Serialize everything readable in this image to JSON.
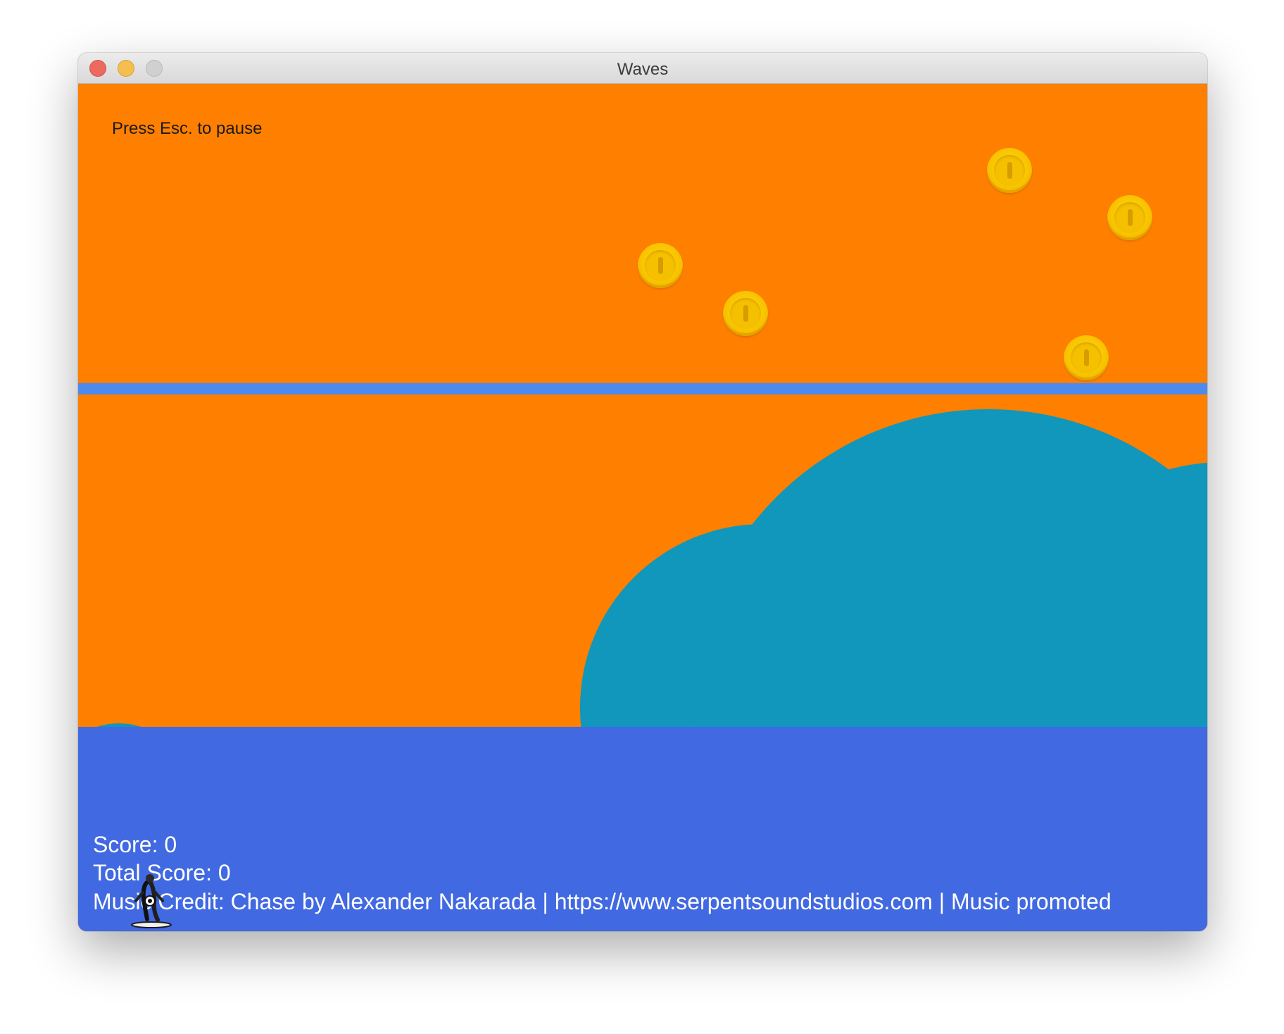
{
  "window": {
    "title": "Waves"
  },
  "hud": {
    "pause_hint": "Press Esc. to pause",
    "score": "Score: 0",
    "total_score": "Total Score: 0",
    "music_credit": "Music Credit: Chase by Alexander Nakarada | https://www.serpentsoundstudios.com | Music promoted"
  },
  "colors": {
    "sky": "#ff7f00",
    "horizon_line": "#4d8af0",
    "sea": "#4169e1",
    "hills": "#1097bb",
    "coin": "#f9c500"
  },
  "icons": {
    "coin": "coin-icon",
    "player": "surfer-icon",
    "window_controls": [
      "close-icon",
      "minimize-icon",
      "zoom-icon"
    ]
  }
}
